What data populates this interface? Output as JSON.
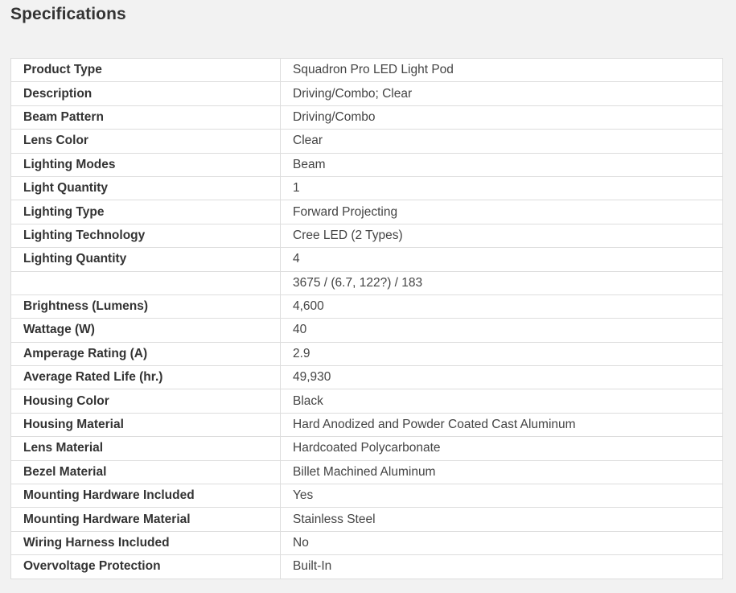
{
  "page": {
    "title": "Specifications"
  },
  "specs": [
    {
      "label": "Product Type",
      "value": "Squadron Pro LED Light Pod"
    },
    {
      "label": "Description",
      "value": "Driving/Combo; Clear"
    },
    {
      "label": "Beam Pattern",
      "value": "Driving/Combo"
    },
    {
      "label": "Lens Color",
      "value": "Clear"
    },
    {
      "label": "Lighting Modes",
      "value": "Beam"
    },
    {
      "label": "Light Quantity",
      "value": "1"
    },
    {
      "label": "Lighting Type",
      "value": "Forward Projecting"
    },
    {
      "label": "Lighting Technology",
      "value": "Cree LED (2 Types)"
    },
    {
      "label": "Lighting Quantity",
      "value": "4"
    },
    {
      "label": "",
      "value": "3675 / (6.7, 122?) / 183"
    },
    {
      "label": "Brightness (Lumens)",
      "value": "4,600"
    },
    {
      "label": "Wattage (W)",
      "value": "40"
    },
    {
      "label": "Amperage Rating (A)",
      "value": "2.9"
    },
    {
      "label": "Average Rated Life (hr.)",
      "value": "49,930"
    },
    {
      "label": "Housing Color",
      "value": "Black"
    },
    {
      "label": "Housing Material",
      "value": "Hard Anodized and Powder Coated Cast Aluminum"
    },
    {
      "label": "Lens Material",
      "value": "Hardcoated Polycarbonate"
    },
    {
      "label": "Bezel Material",
      "value": "Billet Machined Aluminum"
    },
    {
      "label": "Mounting Hardware Included",
      "value": "Yes"
    },
    {
      "label": "Mounting Hardware Material",
      "value": "Stainless Steel"
    },
    {
      "label": "Wiring Harness Included",
      "value": "No"
    },
    {
      "label": "Overvoltage Protection",
      "value": "Built-In"
    }
  ]
}
